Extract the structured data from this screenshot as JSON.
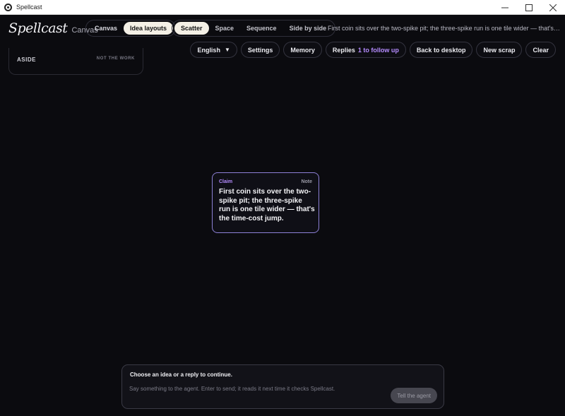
{
  "window": {
    "title": "Spellcast",
    "minimize_icon": "minimize-icon",
    "maximize_icon": "maximize-icon",
    "close_icon": "close-icon"
  },
  "header": {
    "brand": "Spellcast",
    "brand_sub": "Canvas",
    "view_tabs": [
      "Canvas",
      "Idea layouts"
    ],
    "active_view": "Idea layouts",
    "layout_tabs": [
      "Scatter",
      "Space",
      "Sequence",
      "Side by side"
    ],
    "active_layout": "Scatter",
    "breadcrumb": "First coin sits over the two-spike pit; the three-spike run is one tile wider — that's the time-cost jump."
  },
  "toolbar": {
    "language": "English",
    "settings": "Settings",
    "memory": "Memory",
    "replies": "Replies",
    "replies_badge": "1 to follow up",
    "back": "Back to desktop",
    "new_scrap": "New scrap",
    "clear": "Clear"
  },
  "aside": {
    "label": "ASIDE",
    "note": "NOT THE WORK"
  },
  "claim_card": {
    "tag": "Claim",
    "kind": "Note",
    "text": "First coin sits over the two-spike pit; the three-spike run is one tile wider — that's the time-cost jump."
  },
  "composer": {
    "title": "Choose an idea or a reply to continue.",
    "placeholder": "Say something to the agent. Enter to send; it reads it next time it checks Spellcast.",
    "send": "Tell the agent"
  },
  "colors": {
    "background": "#0b0b0f",
    "accent": "#b58cff",
    "card_border": "#8d80d6",
    "active_pill": "#f4f0e6"
  }
}
